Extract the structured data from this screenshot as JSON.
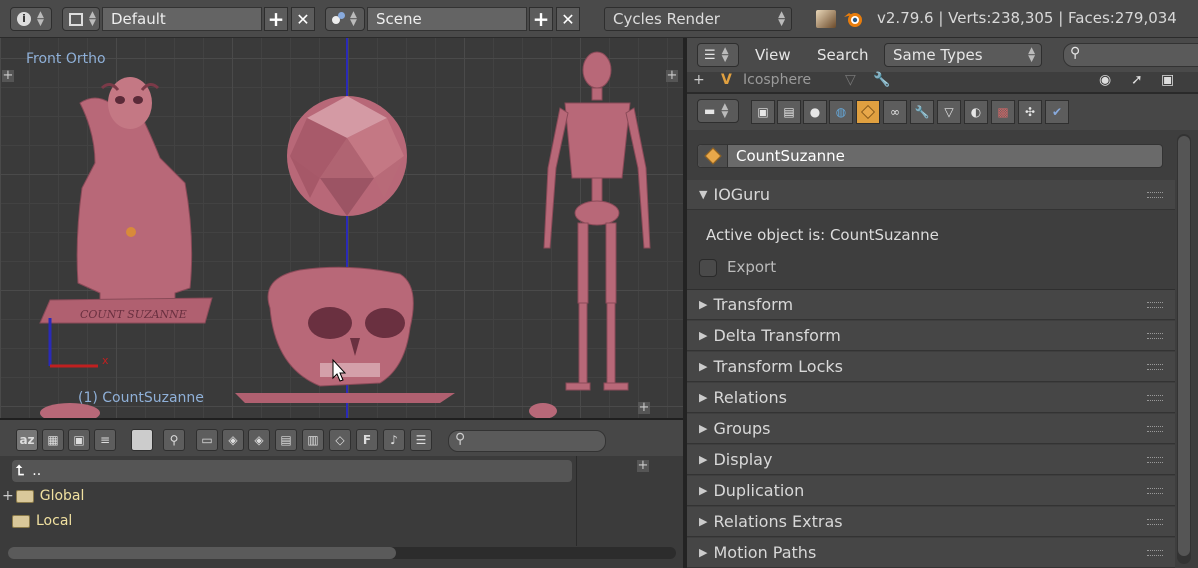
{
  "topbar": {
    "layout_name": "Default",
    "scene_name": "Scene",
    "render_engine": "Cycles Render",
    "stats": "v2.79.6 | Verts:238,305 | Faces:279,034"
  },
  "viewport": {
    "view_label": "Front Ortho",
    "object_label": "(1) CountSuzanne",
    "x_axis_letter": "x",
    "statue_text": "COUNT SUZANNE"
  },
  "filebrowser": {
    "parent_label": "..",
    "items": [
      {
        "label": "Global"
      },
      {
        "label": "Local"
      }
    ]
  },
  "outliner": {
    "menu_view": "View",
    "menu_search": "Search",
    "filter_mode": "Same Types",
    "row_name": "Icosphere"
  },
  "properties": {
    "object_name": "CountSuzanne",
    "addon_panel": {
      "title": "IOGuru",
      "active_text": "Active object is: CountSuzanne",
      "export_label": "Export"
    },
    "panels": [
      {
        "title": "Transform"
      },
      {
        "title": "Delta Transform"
      },
      {
        "title": "Transform Locks"
      },
      {
        "title": "Relations"
      },
      {
        "title": "Groups"
      },
      {
        "title": "Display"
      },
      {
        "title": "Duplication"
      },
      {
        "title": "Relations Extras"
      },
      {
        "title": "Motion Paths"
      }
    ]
  },
  "colors": {
    "accent_orange": "#e0a040",
    "model_pink": "#c0707e",
    "axis_blue": "#2a2ab8",
    "axis_red": "#c02020"
  }
}
